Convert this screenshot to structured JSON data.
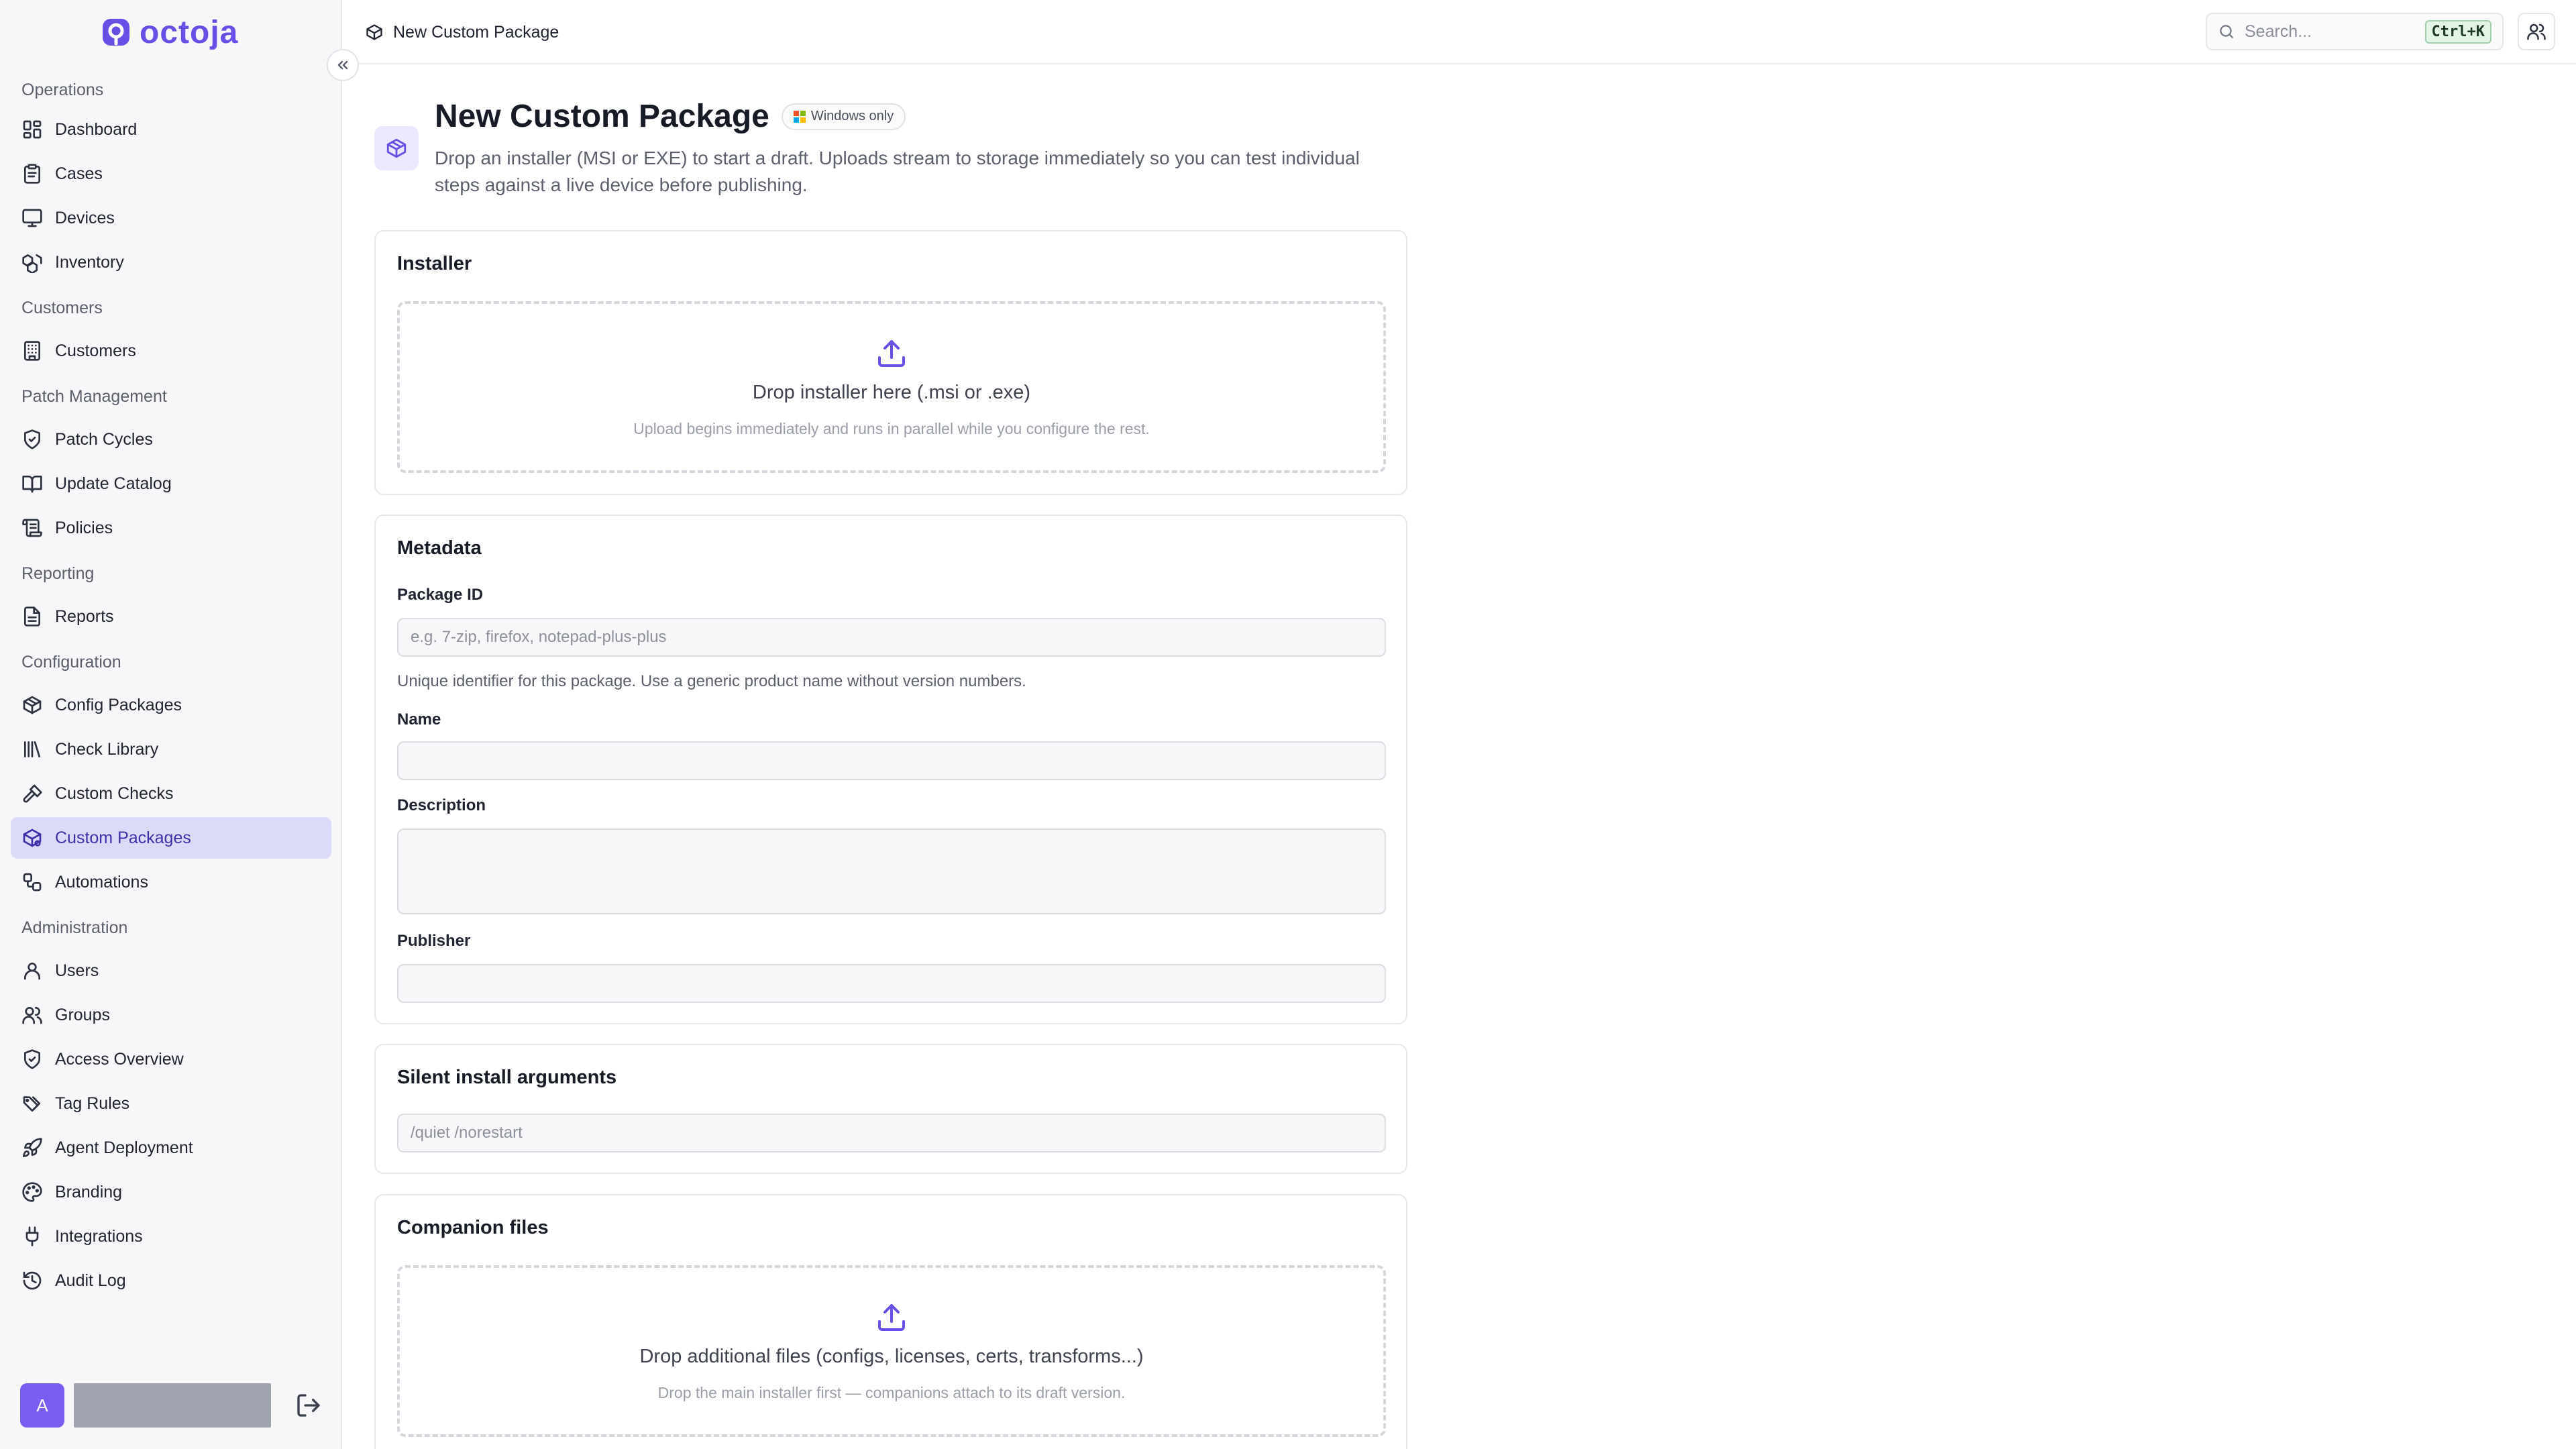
{
  "app": {
    "logo_text": "octoja",
    "accent_color": "#6a4fe6"
  },
  "sidebar": {
    "sections": [
      {
        "title": "Operations",
        "items": [
          {
            "label": "Dashboard",
            "icon": "layout-dashboard-icon"
          },
          {
            "label": "Cases",
            "icon": "clipboard-icon"
          },
          {
            "label": "Devices",
            "icon": "monitor-icon"
          },
          {
            "label": "Inventory",
            "icon": "boxes-icon"
          }
        ]
      },
      {
        "title": "Customers",
        "items": [
          {
            "label": "Customers",
            "icon": "building-icon"
          }
        ]
      },
      {
        "title": "Patch Management",
        "items": [
          {
            "label": "Patch Cycles",
            "icon": "shield-check-icon"
          },
          {
            "label": "Update Catalog",
            "icon": "book-open-icon"
          },
          {
            "label": "Policies",
            "icon": "scroll-icon"
          }
        ]
      },
      {
        "title": "Reporting",
        "items": [
          {
            "label": "Reports",
            "icon": "file-text-icon"
          }
        ]
      },
      {
        "title": "Configuration",
        "items": [
          {
            "label": "Config Packages",
            "icon": "package-icon"
          },
          {
            "label": "Check Library",
            "icon": "library-icon"
          },
          {
            "label": "Custom Checks",
            "icon": "hammer-icon"
          },
          {
            "label": "Custom Packages",
            "icon": "package-cog-icon",
            "active": true
          },
          {
            "label": "Automations",
            "icon": "workflow-icon"
          }
        ]
      },
      {
        "title": "Administration",
        "items": [
          {
            "label": "Users",
            "icon": "user-icon"
          },
          {
            "label": "Groups",
            "icon": "users-icon"
          },
          {
            "label": "Access Overview",
            "icon": "shield-icon"
          },
          {
            "label": "Tag Rules",
            "icon": "tags-icon"
          },
          {
            "label": "Agent Deployment",
            "icon": "rocket-icon"
          },
          {
            "label": "Branding",
            "icon": "palette-icon"
          },
          {
            "label": "Integrations",
            "icon": "plug-icon"
          },
          {
            "label": "Audit Log",
            "icon": "history-icon"
          }
        ]
      }
    ]
  },
  "user": {
    "initial": "A"
  },
  "topbar": {
    "breadcrumb": "New Custom Package",
    "search_placeholder": "Search...",
    "search_shortcut": "Ctrl+K"
  },
  "page": {
    "title": "New Custom Package",
    "badge": "Windows only",
    "description": "Drop an installer (MSI or EXE) to start a draft. Uploads stream to storage immediately so you can test individual steps against a live device before publishing."
  },
  "installer": {
    "title": "Installer",
    "drop_text": "Drop installer here (.msi or .exe)",
    "drop_hint": "Upload begins immediately and runs in parallel while you configure the rest."
  },
  "metadata": {
    "title": "Metadata",
    "package_id_label": "Package ID",
    "package_id_placeholder": "e.g. 7-zip, firefox, notepad-plus-plus",
    "package_id_help": "Unique identifier for this package. Use a generic product name without version numbers.",
    "name_label": "Name",
    "description_label": "Description",
    "publisher_label": "Publisher"
  },
  "silent_args": {
    "title": "Silent install arguments",
    "placeholder": "/quiet /norestart"
  },
  "companion": {
    "title": "Companion files",
    "drop_text": "Drop additional files (configs, licenses, certs, transforms...)",
    "drop_hint": "Drop the main installer first — companions attach to its draft version."
  }
}
